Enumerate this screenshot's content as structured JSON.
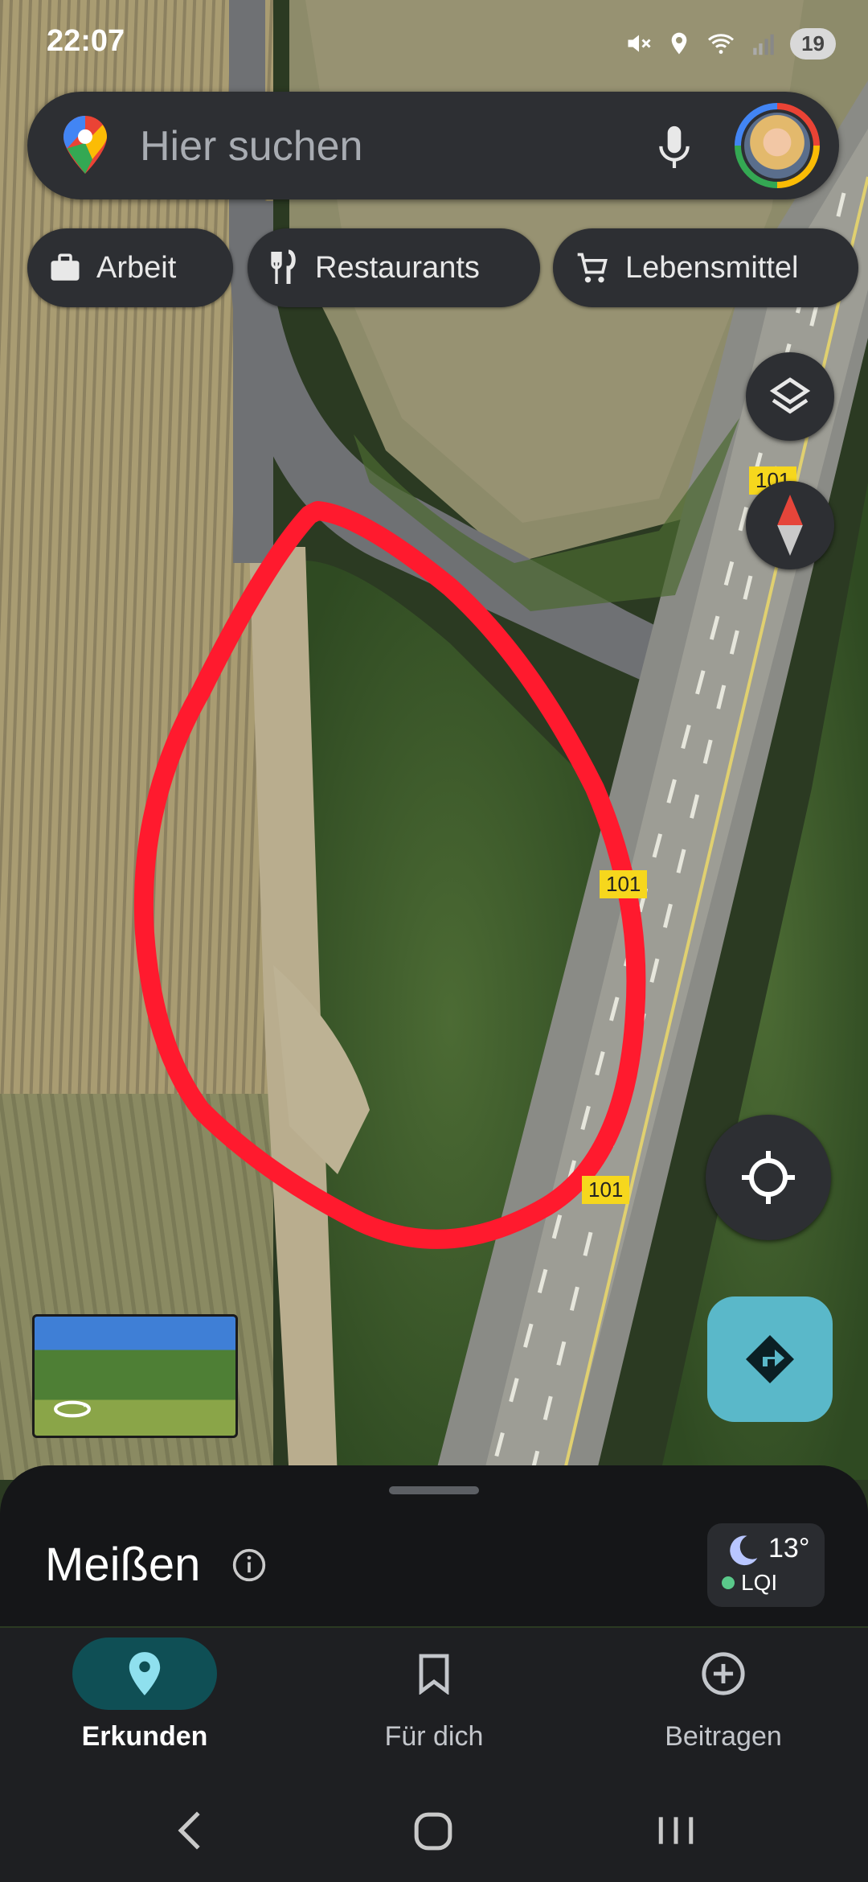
{
  "status_bar": {
    "time": "22:07",
    "battery": "19"
  },
  "search": {
    "placeholder": "Hier suchen"
  },
  "chips": [
    {
      "label": "Arbeit",
      "icon": "briefcase-icon"
    },
    {
      "label": "Restaurants",
      "icon": "fork-knife-icon"
    },
    {
      "label": "Lebensmittel",
      "icon": "shopping-cart-icon"
    }
  ],
  "map": {
    "road_badges": [
      "101",
      "101",
      "101"
    ],
    "annotation_color": "#ff1a2e",
    "fields_color": "#a89a6e",
    "vegetation_color": "#3d5a2a"
  },
  "sheet": {
    "place_name": "Meißen",
    "temperature": "13°",
    "air_quality": "LQI"
  },
  "bottom_nav": {
    "items": [
      {
        "label": "Erkunden",
        "icon": "location-pin-icon",
        "active": true
      },
      {
        "label": "Für dich",
        "icon": "bookmark-icon",
        "active": false
      },
      {
        "label": "Beitragen",
        "icon": "add-circle-icon",
        "active": false
      }
    ]
  },
  "colors": {
    "accent": "#5ab8c9",
    "active_pill": "#0f4f55",
    "surface": "#2d2f33"
  }
}
